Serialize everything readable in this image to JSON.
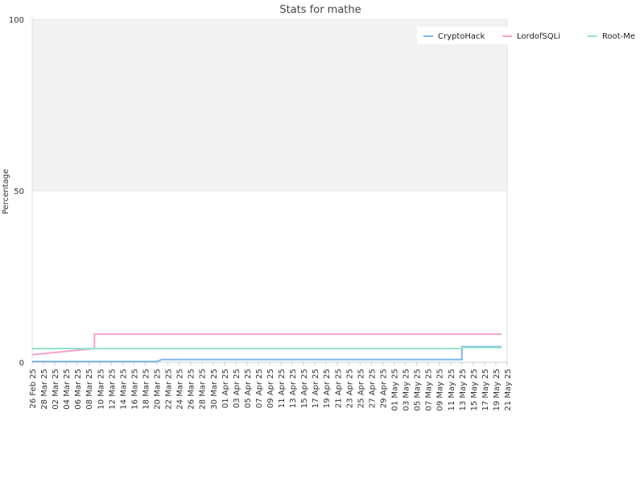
{
  "chart_data": {
    "type": "line",
    "title": "Stats for mathe",
    "xlabel": "",
    "ylabel": "Percentage",
    "ylim": [
      0,
      100
    ],
    "yticks": [
      0,
      50,
      100
    ],
    "xlim": [
      "2025-02-26",
      "2025-05-21"
    ],
    "xtick_labels": [
      "26 Feb 25",
      "28 Mar 25",
      "02 Mar 25",
      "04 Mar 25",
      "06 Mar 25",
      "08 Mar 25",
      "10 Mar 25",
      "12 Mar 25",
      "14 Mar 25",
      "16 Mar 25",
      "18 Mar 25",
      "20 Mar 25",
      "22 Mar 25",
      "24 Mar 25",
      "26 Mar 25",
      "28 Mar 25",
      "30 Mar 25",
      "01 Apr 25",
      "03 Apr 25",
      "05 Apr 25",
      "07 Apr 25",
      "09 Apr 25",
      "11 Apr 25",
      "13 Apr 25",
      "15 Apr 25",
      "17 Apr 25",
      "19 Apr 25",
      "21 Apr 25",
      "23 Apr 25",
      "25 Apr 25",
      "27 Apr 25",
      "29 Apr 25",
      "01 May 25",
      "03 May 25",
      "05 May 25",
      "07 May 25",
      "09 May 25",
      "11 May 25",
      "13 May 25",
      "15 May 25",
      "17 May 25",
      "19 May 25",
      "21 May 25"
    ],
    "grid": true,
    "legend_position": "top-right",
    "background_upper": "#f2f2f2",
    "series": [
      {
        "name": "CryptoHack",
        "color": "#7cb5ec",
        "points": [
          [
            "2025-02-26",
            0.2
          ],
          [
            "2025-03-20",
            0.2
          ],
          [
            "2025-03-21",
            0.8
          ],
          [
            "2025-05-13",
            0.8
          ],
          [
            "2025-05-13",
            4.5
          ],
          [
            "2025-05-20",
            4.5
          ]
        ]
      },
      {
        "name": "LordofSQLi",
        "color": "#f7a1d0",
        "points": [
          [
            "2025-02-26",
            2.2
          ],
          [
            "2025-03-09",
            4.0
          ],
          [
            "2025-03-09",
            8.2
          ],
          [
            "2025-05-20",
            8.2
          ]
        ]
      },
      {
        "name": "Root-Me",
        "color": "#90e5cf",
        "points": [
          [
            "2025-02-26",
            4.0
          ],
          [
            "2025-05-13",
            4.0
          ],
          [
            "2025-05-13",
            4.3
          ],
          [
            "2025-05-20",
            4.3
          ]
        ]
      }
    ]
  }
}
